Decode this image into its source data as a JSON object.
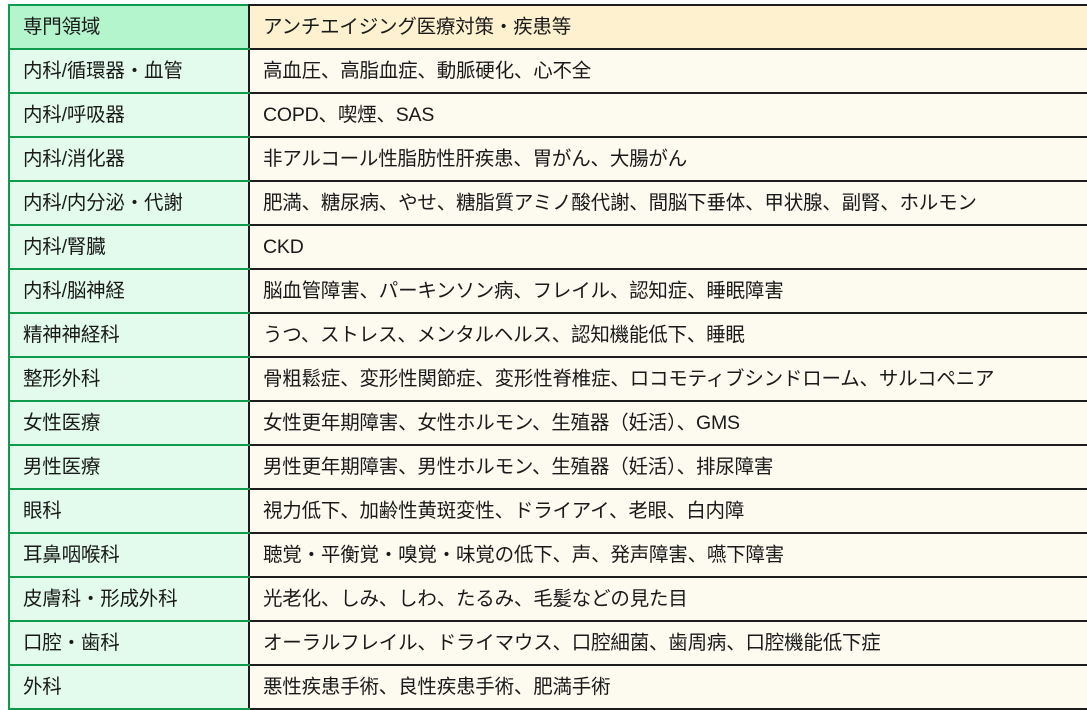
{
  "table": {
    "columns": [
      "専門領域",
      "アンチエイジング医療対策・疾患等"
    ],
    "header": {
      "area": "専門領域",
      "items": "アンチエイジング医療対策・疾患等"
    },
    "colors": {
      "header_area_bg": "#b5f5cd",
      "header_items_bg": "#fdf1cf",
      "body_area_bg": "#e2fbec",
      "body_items_bg": "#fdfaf0",
      "green_border": "#0f9b4b",
      "dark_border": "#1c1c1c",
      "text": "#1a1a1a"
    },
    "rows": [
      {
        "area": "内科/循環器・血管",
        "items": "高血圧、高脂血症、動脈硬化、心不全"
      },
      {
        "area": "内科/呼吸器",
        "items": "COPD、喫煙、SAS"
      },
      {
        "area": "内科/消化器",
        "items": "非アルコール性脂肪性肝疾患、胃がん、大腸がん"
      },
      {
        "area": "内科/内分泌・代謝",
        "items": "肥満、糖尿病、やせ、糖脂質アミノ酸代謝、間脳下垂体、甲状腺、副腎、ホルモン"
      },
      {
        "area": "内科/腎臓",
        "items": "CKD"
      },
      {
        "area": "内科/脳神経",
        "items": "脳血管障害、パーキンソン病、フレイル、認知症、睡眠障害"
      },
      {
        "area": "精神神経科",
        "items": "うつ、ストレス、メンタルヘルス、認知機能低下、睡眠"
      },
      {
        "area": "整形外科",
        "items": "骨粗鬆症、変形性関節症、変形性脊椎症、ロコモティブシンドローム、サルコペニア"
      },
      {
        "area": "女性医療",
        "items": "女性更年期障害、女性ホルモン、生殖器（妊活）、GMS"
      },
      {
        "area": "男性医療",
        "items": "男性更年期障害、男性ホルモン、生殖器（妊活）、排尿障害"
      },
      {
        "area": "眼科",
        "items": "視力低下、加齢性黄斑変性、ドライアイ、老眼、白内障"
      },
      {
        "area": "耳鼻咽喉科",
        "items": "聴覚・平衡覚・嗅覚・味覚の低下、声、発声障害、嚥下障害"
      },
      {
        "area": "皮膚科・形成外科",
        "items": "光老化、しみ、しわ、たるみ、毛髪などの見た目"
      },
      {
        "area": "口腔・歯科",
        "items": "オーラルフレイル、ドライマウス、口腔細菌、歯周病、口腔機能低下症"
      },
      {
        "area": "外科",
        "items": "悪性疾患手術、良性疾患手術、肥満手術"
      }
    ]
  }
}
